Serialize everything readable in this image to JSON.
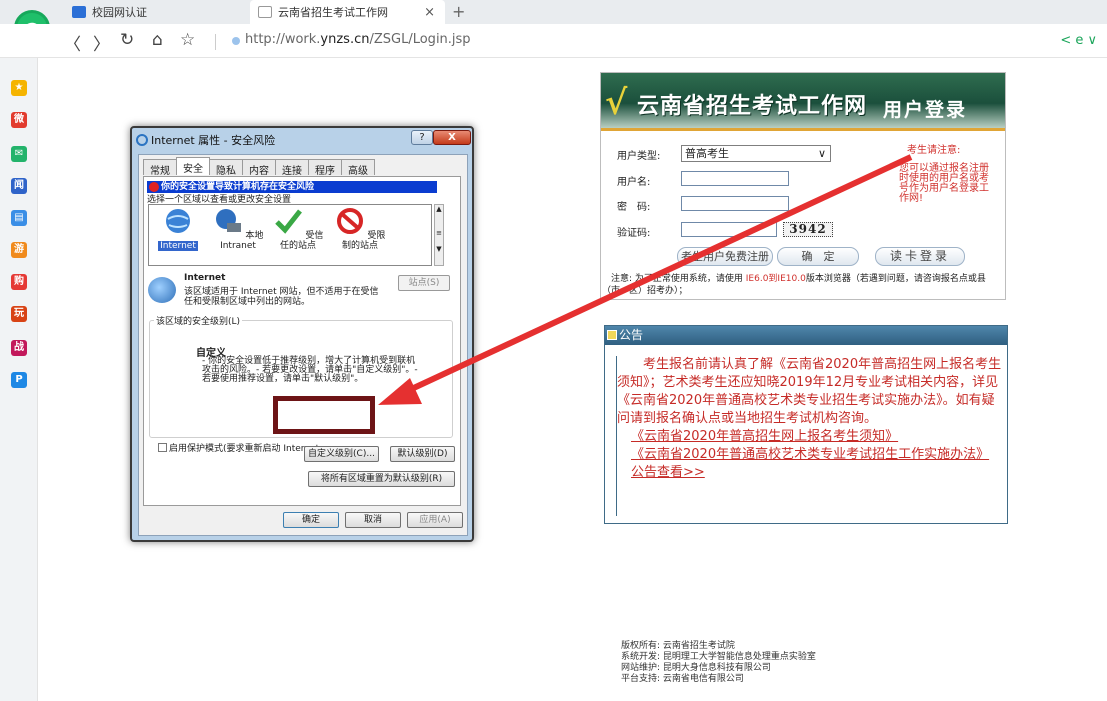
{
  "browser": {
    "tabs": [
      {
        "label": "校园网认证"
      },
      {
        "label": "云南省招生考试工作网"
      }
    ],
    "tab_close": "×",
    "new_tab": "+",
    "url_prefix": "http://work.",
    "url_domain": "ynzs.cn",
    "url_path": "/ZSGL/Login.jsp",
    "nav": {
      "back": "〈",
      "forward": "〉",
      "reload": "↻",
      "home": "⌂",
      "star": "☆"
    },
    "right_icons": "< e ∨"
  },
  "sidebar": {
    "icons": [
      "star-icon",
      "weibo-icon",
      "mail-icon",
      "news-icon",
      "notes-icon",
      "game-icon",
      "app-icon",
      "game2-icon",
      "game3-icon",
      "tool-icon"
    ],
    "colors": [
      "#f5b400",
      "#e23b2e",
      "#23b36b",
      "#2f63c9",
      "#3a8ee6",
      "#f08a1c",
      "#e53935",
      "#d84315",
      "#c2185b",
      "#1e88e5"
    ]
  },
  "login": {
    "banner_title": "云南省招生考试工作网",
    "banner_sub": "用户登录",
    "user_type_label": "用户类型:",
    "user_type_value": "普高考生",
    "username_label": "用户名:",
    "password_label": "密　码:",
    "captcha_label": "验证码:",
    "captcha_value": "3942",
    "btn_register": "考生用户免费注册",
    "btn_confirm": "确　定",
    "btn_card": "读卡登录",
    "notice_prefix": "　注意: 为了正常使用系统，请使用 ",
    "notice_highlight": "IE6.0到IE10.0",
    "notice_suffix": "版本浏览器（若遇到问题，请咨询报名点或县（市、区）招考办）；",
    "side_title": "考生请注意:",
    "side_text": "您可以通过报名注册时使用的用户名或考号作为用户名登录工作网!"
  },
  "announcement": {
    "title": "公告",
    "text": "考生报名前请认真了解《云南省2020年普高招生网上报名考生须知》；艺术类考生还应知晓2019年12月专业考试相关内容，详见《云南省2020年普通高校艺术类专业招生考试实施办法》。如有疑问请到报名确认点或当地招生考试机构咨询。",
    "links": [
      "《云南省2020年普高招生网上报名考生须知》",
      "《云南省2020年普通高校艺术类专业考试招生工作实施办法》",
      "公告查看>>"
    ]
  },
  "footer": {
    "lines": [
      "版权所有: 云南省招生考试院",
      "系统开发: 昆明理工大学智能信息处理重点实验室",
      "网站维护: 昆明大身信息科技有限公司",
      "平台支持: 云南省电信有限公司"
    ]
  },
  "dialog": {
    "title": "Internet 属性 - 安全风险",
    "help": "?",
    "close": "X",
    "tabs": [
      "常规",
      "安全",
      "隐私",
      "内容",
      "连接",
      "程序",
      "高级"
    ],
    "warning": "你的安全设置导致计算机存在安全风险",
    "zone_hint": "选择一个区域以查看或更改安全设置",
    "zones": [
      {
        "label": "Internet",
        "icon": "globe-icon"
      },
      {
        "label": "本地 Intranet",
        "icon": "intranet-icon"
      },
      {
        "label": "受信任的站点",
        "icon": "trusted-check-icon"
      },
      {
        "label": "受限制的站点",
        "icon": "restricted-icon"
      }
    ],
    "zone_info_title": "Internet",
    "zone_info": "该区域适用于 Internet 网站，但不适用于在受信任和受限制区域中列出的网站。",
    "sites_button": "站点(S)",
    "level_legend": "该区域的安全级别(L)",
    "level_title": "自定义",
    "level_desc": "- 你的安全设置低于推荐级别，增大了计算机受到联机攻击的风险。- 若要更改设置，请单击\"自定义级别\"。- 若要使用推荐设置，请单击\"默认级别\"。",
    "protect_mode": "启用保护模式(要求重新启动 Internet",
    "btn_custom": "自定义级别(C)...",
    "btn_default": "默认级别(D)",
    "btn_reset": "将所有区域重置为默认级别(R)",
    "btn_ok": "确定",
    "btn_cancel": "取消",
    "btn_apply": "应用(A)"
  }
}
